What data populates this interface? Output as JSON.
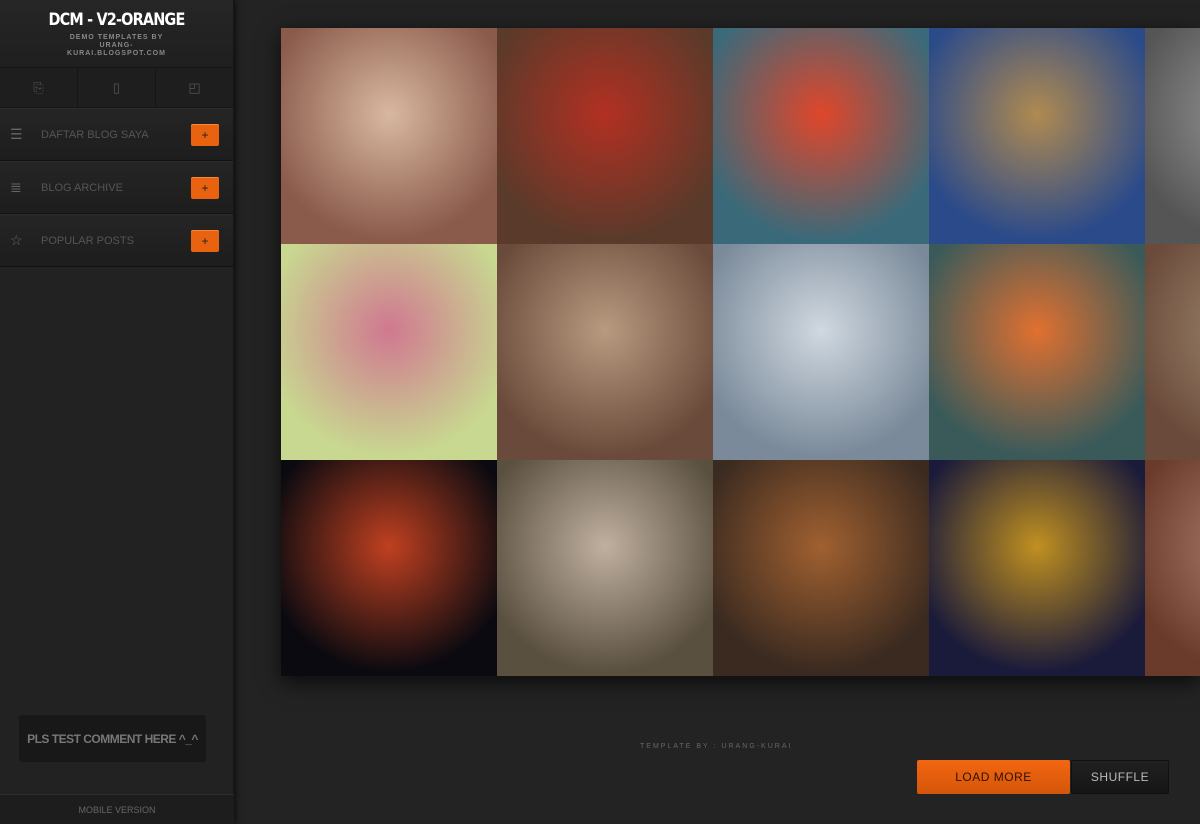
{
  "sidebar": {
    "title": "DCM - V2-ORANGE",
    "subtitle": "DEMO TEMPLATES BY URANG-KURAI.BLOGSPOT.COM",
    "icons": [
      "pdf-icon",
      "document-icon",
      "chart-document-icon"
    ],
    "items": [
      {
        "label": "DAFTAR BLOG SAYA",
        "icon": "list-icon",
        "button": "+"
      },
      {
        "label": "BLOG ARCHIVE",
        "icon": "archive-icon",
        "button": "+"
      },
      {
        "label": "POPULAR POSTS",
        "icon": "star-icon",
        "button": "+"
      }
    ],
    "comment": "PLS TEST COMMENT HERE ^_^",
    "mobile": "MOBILE VERSION"
  },
  "gallery": {
    "tiles": [
      "#8a5a4a,#d8b8a0",
      "#5a3a2a,#b23022",
      "#3a6a7a,#e0462a",
      "#2a4a8a,#b08a50",
      "#555,#999",
      "#c8d890,#d07890",
      "#6a4a3a,#b89a80",
      "#7a8a9a,#d0d8e0",
      "#3a5a5a,#e07030",
      "#6a4a3a,#a08a70",
      "#0a0a10,#c04020",
      "#5a5040,#c0b0a0",
      "#3a2a20,#a06030",
      "#1a1a3a,#c09020",
      "#6a3a2a,#b08070"
    ]
  },
  "footer": {
    "credit": "TEMPLATE BY : URANG-KURAI",
    "load_more": "LOAD MORE",
    "shuffle": "SHUFFLE"
  },
  "colors": {
    "accent": "#e8620f"
  }
}
